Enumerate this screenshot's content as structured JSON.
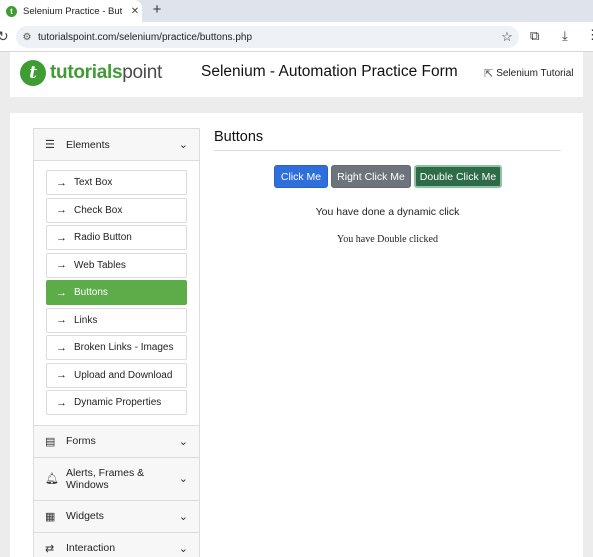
{
  "browser": {
    "tab_title": "Selenium Practice - Buttons",
    "new_tab": "+",
    "url": "tutorialspoint.com/selenium/practice/buttons.php"
  },
  "header": {
    "logo_bold": "tutorials",
    "logo_thin": "point",
    "title": "Selenium - Automation Practice Form",
    "link": "Selenium Tutorial"
  },
  "sidebar": {
    "elements_label": "Elements",
    "items": [
      {
        "label": "Text Box"
      },
      {
        "label": "Check Box"
      },
      {
        "label": "Radio Button"
      },
      {
        "label": "Web Tables"
      },
      {
        "label": "Buttons"
      },
      {
        "label": "Links"
      },
      {
        "label": "Broken Links - Images"
      },
      {
        "label": "Upload and Download"
      },
      {
        "label": "Dynamic Properties"
      }
    ],
    "sections": [
      {
        "label": "Forms"
      },
      {
        "label": "Alerts, Frames & Windows"
      },
      {
        "label": "Widgets"
      },
      {
        "label": "Interaction"
      }
    ]
  },
  "content": {
    "title": "Buttons",
    "buttons": {
      "click_me": "Click Me",
      "right_click_me": "Right Click Me",
      "double_click_me": "Double Click Me"
    },
    "message_dynamic": "You have done a dynamic click",
    "message_double": "You have Double clicked"
  },
  "colors": {
    "brand_green": "#3f9c35",
    "active_item": "#5cad4a",
    "primary_button": "#2f6fdc",
    "secondary_button": "#6d747b",
    "success_button": "#2e6b48"
  }
}
